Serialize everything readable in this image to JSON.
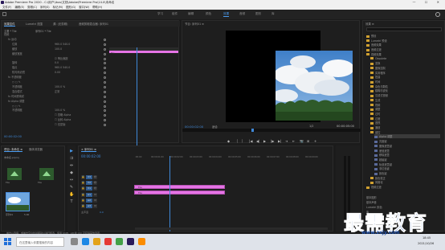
{
  "window": {
    "title": "Adobe Premiere Pro 2020 - C:\\用户\\ibus\\文档\\Adobe\\Premiere Pro\\14.0\\未命名",
    "controls": "—  ☐  ✕"
  },
  "menu": [
    "文件(F)",
    "编辑(E)",
    "剪辑(C)",
    "序列(S)",
    "标记(M)",
    "图形(G)",
    "窗口(W)",
    "帮助(H)"
  ],
  "workspaces": [
    {
      "label": "学习",
      "active": false
    },
    {
      "label": "组件",
      "active": false
    },
    {
      "label": "编辑",
      "active": false
    },
    {
      "label": "颜色",
      "active": false
    },
    {
      "label": "效果",
      "active": true
    },
    {
      "label": "音频",
      "active": false
    },
    {
      "label": "图形",
      "active": false
    },
    {
      "label": "库",
      "active": false
    }
  ],
  "effect_controls": {
    "tabs": [
      "效果控件",
      "Lumetri 范围",
      "源: (无剪辑)",
      "音频剪辑混合器: 序列01"
    ],
    "source_label": "主要 * Tile",
    "clip_label": "序列01 * Tile",
    "rows": [
      {
        "label": "视频",
        "indent": 0,
        "value": ""
      },
      {
        "label": "fx 运动",
        "indent": 1,
        "value": ""
      },
      {
        "label": "位置",
        "indent": 2,
        "value": "960.0  540.0"
      },
      {
        "label": "缩放",
        "indent": 2,
        "value": "100.0"
      },
      {
        "label": "缩放宽度",
        "indent": 2,
        "value": ""
      },
      {
        "label": "",
        "indent": 2,
        "value": "☑ 等比缩放"
      },
      {
        "label": "旋转",
        "indent": 2,
        "value": "0.0"
      },
      {
        "label": "锚点",
        "indent": 2,
        "value": "960.0  540.0"
      },
      {
        "label": "防闪烁滤镜",
        "indent": 2,
        "value": "0.00"
      },
      {
        "label": "fx 不透明度",
        "indent": 1,
        "value": ""
      },
      {
        "label": "○ □ ✎",
        "indent": 2,
        "value": ""
      },
      {
        "label": "不透明度",
        "indent": 2,
        "value": "100.0 %"
      },
      {
        "label": "混合模式",
        "indent": 2,
        "value": "正常"
      },
      {
        "label": "fx 时间重映射",
        "indent": 1,
        "value": ""
      },
      {
        "label": "fx Alpha 调整",
        "indent": 1,
        "value": ""
      },
      {
        "label": "○ □ ✎",
        "indent": 2,
        "value": ""
      },
      {
        "label": "不透明度",
        "indent": 2,
        "value": "100.0 %"
      },
      {
        "label": "",
        "indent": 2,
        "value": "☐ 忽略 Alpha"
      },
      {
        "label": "",
        "indent": 2,
        "value": "☐ 反转 Alpha"
      },
      {
        "label": "",
        "indent": 2,
        "value": "☐ 仅蒙版"
      }
    ],
    "track_label": "Tile",
    "timecode": "00:00:02:00"
  },
  "program_monitor": {
    "title": "节目: 序列01 ≡",
    "timecode": "00:00:02:00",
    "fit": "适合",
    "fraction": "1/2",
    "duration": "00:00:05:00",
    "controls": [
      "◆",
      "｛",
      "｝",
      "|◀",
      "◀|",
      "▶",
      "|▶",
      "▶|",
      "⇥",
      "⇤",
      "📷",
      "⊞",
      "+"
    ]
  },
  "effects": {
    "title": "效果 ≡",
    "items": [
      {
        "label": "预设",
        "depth": 0,
        "type": "folder"
      },
      {
        "label": "Lumetri 预设",
        "depth": 0,
        "type": "folder"
      },
      {
        "label": "音频效果",
        "depth": 0,
        "type": "folder"
      },
      {
        "label": "音频过渡",
        "depth": 0,
        "type": "folder"
      },
      {
        "label": "视频效果",
        "depth": 0,
        "type": "folder"
      },
      {
        "label": "Obsolete",
        "depth": 1,
        "type": "folder"
      },
      {
        "label": "变换",
        "depth": 1,
        "type": "folder"
      },
      {
        "label": "图像控制",
        "depth": 1,
        "type": "folder"
      },
      {
        "label": "实用程序",
        "depth": 1,
        "type": "folder"
      },
      {
        "label": "扭曲",
        "depth": 1,
        "type": "folder"
      },
      {
        "label": "时间",
        "depth": 1,
        "type": "folder"
      },
      {
        "label": "杂色与颗粒",
        "depth": 1,
        "type": "folder"
      },
      {
        "label": "模糊与锐化",
        "depth": 1,
        "type": "folder"
      },
      {
        "label": "沉浸式视频",
        "depth": 1,
        "type": "folder"
      },
      {
        "label": "生成",
        "depth": 1,
        "type": "folder"
      },
      {
        "label": "视频",
        "depth": 1,
        "type": "folder"
      },
      {
        "label": "调整",
        "depth": 1,
        "type": "folder"
      },
      {
        "label": "过时",
        "depth": 1,
        "type": "folder"
      },
      {
        "label": "过渡",
        "depth": 1,
        "type": "folder"
      },
      {
        "label": "透视",
        "depth": 1,
        "type": "folder"
      },
      {
        "label": "通道",
        "depth": 1,
        "type": "folder"
      },
      {
        "label": "键控",
        "depth": 1,
        "type": "folder"
      },
      {
        "label": "Alpha 调整",
        "depth": 2,
        "type": "fx",
        "selected": true
      },
      {
        "label": "亮度键",
        "depth": 2,
        "type": "fx"
      },
      {
        "label": "图像遮罩键",
        "depth": 2,
        "type": "fx"
      },
      {
        "label": "差值遮罩",
        "depth": 2,
        "type": "fx"
      },
      {
        "label": "移除遮罩",
        "depth": 2,
        "type": "fx"
      },
      {
        "label": "超级键",
        "depth": 2,
        "type": "fx"
      },
      {
        "label": "轨道遮罩键",
        "depth": 2,
        "type": "fx"
      },
      {
        "label": "非红色键",
        "depth": 2,
        "type": "fx"
      },
      {
        "label": "颜色键",
        "depth": 2,
        "type": "fx"
      },
      {
        "label": "颜色校正",
        "depth": 1,
        "type": "folder"
      },
      {
        "label": "风格化",
        "depth": 1,
        "type": "folder"
      },
      {
        "label": "视频过渡",
        "depth": 0,
        "type": "folder"
      }
    ],
    "bottom_items": [
      "基本图形",
      "基本声音",
      "Lumetri 颜色",
      "库",
      "标记",
      "历史记录",
      "信息"
    ]
  },
  "project": {
    "tabs": [
      "项目: 未命名 ≡",
      "媒体浏览器"
    ],
    "file_label": "未命名.prproj",
    "items": [
      {
        "name": "Tile",
        "meta": ""
      },
      {
        "name": "Tile",
        "meta": ""
      },
      {
        "name": "序列01",
        "meta": "5:00"
      }
    ]
  },
  "timeline": {
    "title": "× 序列01 ≡",
    "timecode": "00:00:02:00",
    "ticks": [
      ":00:00",
      "00:00:01:00",
      "00:00:02:00",
      "00:00:03:00",
      "00:00:04:00",
      "00:00:05:00",
      "00:00:06:00",
      "00:00:07:00",
      "00:00:08:00",
      "00:00:09:00"
    ],
    "tracks": [
      {
        "name": "V3",
        "type": "video"
      },
      {
        "name": "V2",
        "type": "video",
        "clip": "Tile"
      },
      {
        "name": "V1",
        "type": "video",
        "clip": "Tile"
      },
      {
        "name": "A1",
        "type": "audio"
      },
      {
        "name": "A2",
        "type": "audio"
      },
      {
        "name": "A3",
        "type": "audio"
      },
      {
        "name": "主声道",
        "type": "master",
        "value": "0.0"
      }
    ]
  },
  "status": "单击以选择，或单击空白处并拖动以进行框选，使用 Shift、Alt 和 Ctrl 可获得其他选项。",
  "taskbar": {
    "search_placeholder": "在这里输入你要搜索的内容",
    "time": "18:45",
    "date": "2021/10/26"
  },
  "watermark": {
    "text": "最需教育",
    "url": "www.zxjy.com"
  }
}
